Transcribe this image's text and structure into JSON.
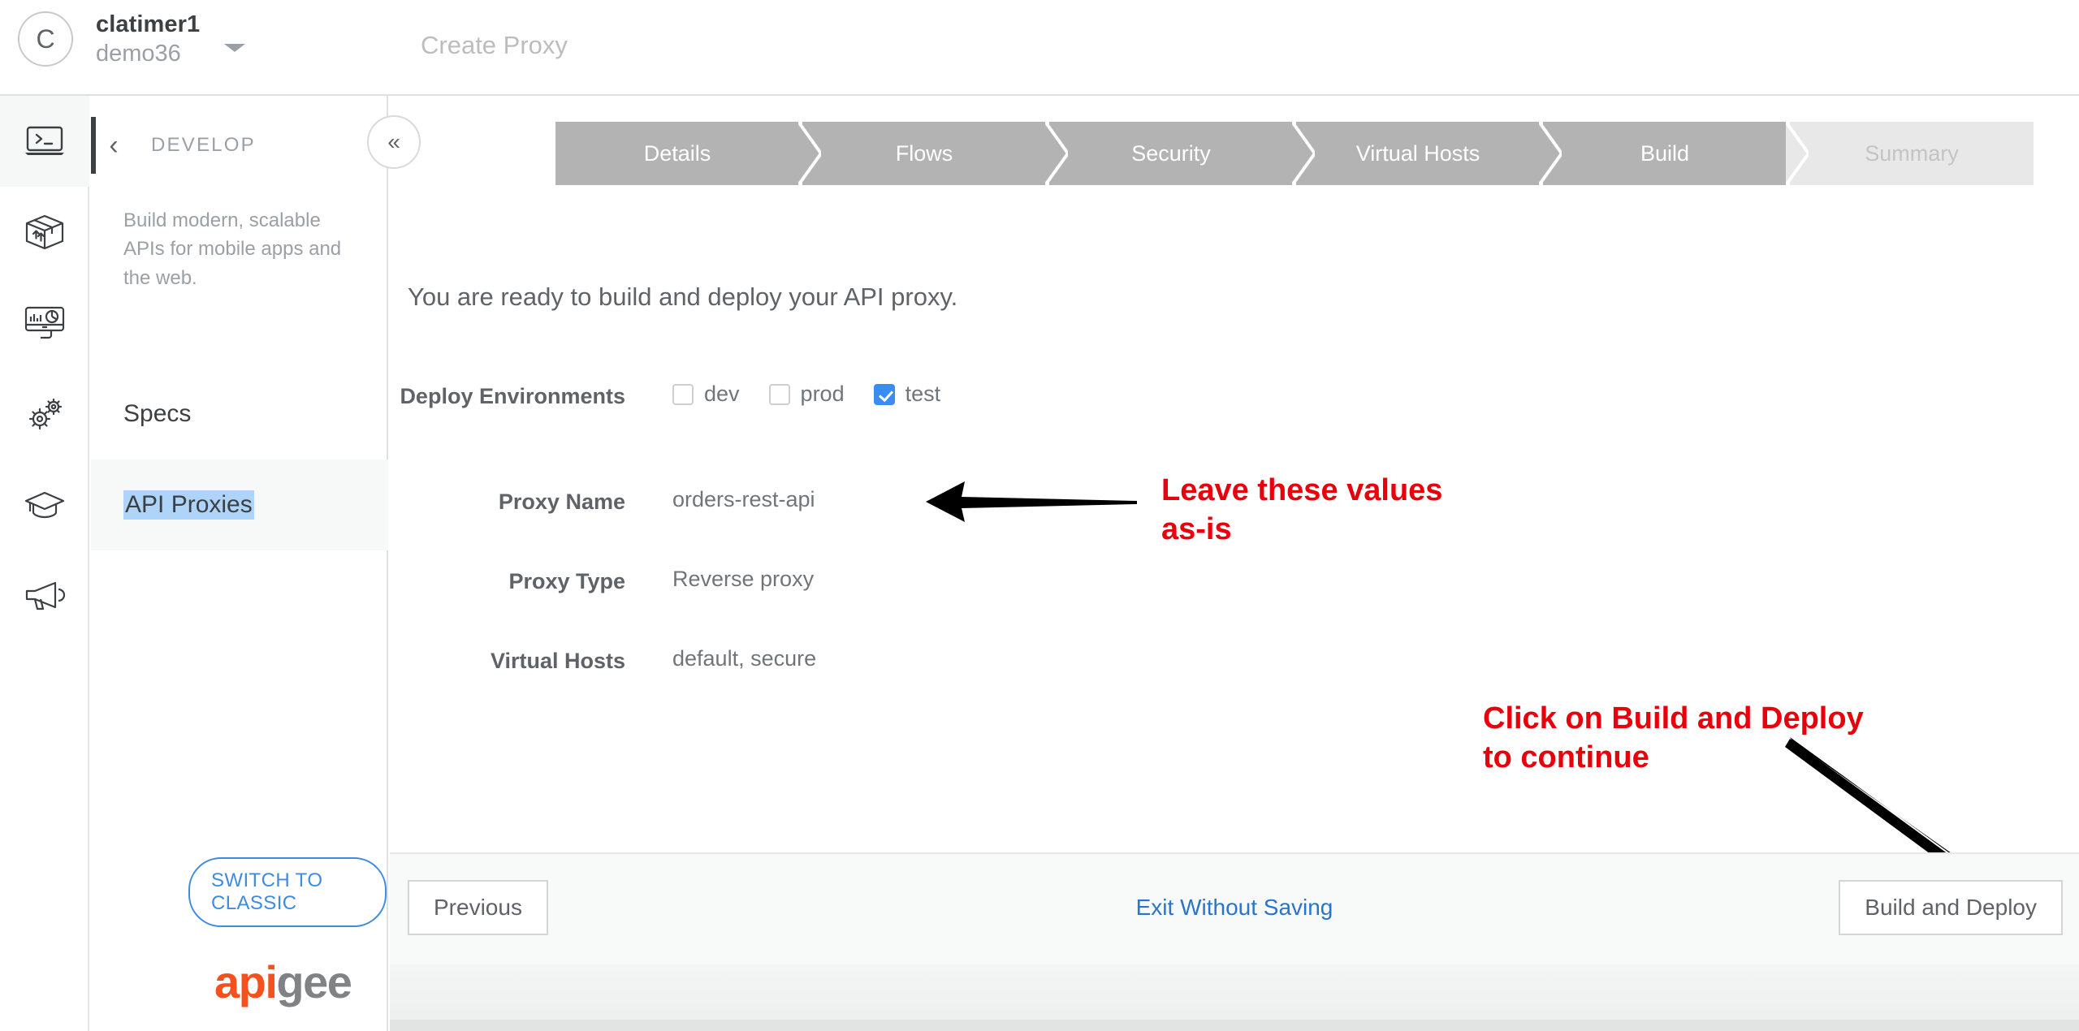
{
  "topbar": {
    "avatar_initial": "C",
    "username": "clatimer1",
    "org": "demo36",
    "page_title": "Create Proxy"
  },
  "rail": {
    "items": [
      {
        "icon": "console-icon",
        "name": "console",
        "active": true
      },
      {
        "icon": "package-icon",
        "name": "publish",
        "active": false
      },
      {
        "icon": "analytics-monitor-icon",
        "name": "analyze",
        "active": false
      },
      {
        "icon": "gears-icon",
        "name": "admin",
        "active": false
      },
      {
        "icon": "graduation-cap-icon",
        "name": "learn",
        "active": false
      },
      {
        "icon": "megaphone-icon",
        "name": "announcements",
        "active": false
      }
    ]
  },
  "develop_panel": {
    "back_icon": "chevron-left-icon",
    "title": "DEVELOP",
    "description": "Build modern, scalable APIs for mobile apps and the web.",
    "links": [
      {
        "label": "Specs",
        "selected": false,
        "highlighted": false
      },
      {
        "label": "API Proxies",
        "selected": true,
        "highlighted": true
      }
    ],
    "switch_classic": "SWITCH TO CLASSIC",
    "logo": {
      "part1": "api",
      "part2": "gee",
      "color1": "#f4511e",
      "color2": "#808285"
    }
  },
  "collapse_button": {
    "icon": "double-chevron-left-icon",
    "label": "«"
  },
  "wizard": {
    "steps": [
      {
        "label": "Details",
        "state": "done"
      },
      {
        "label": "Flows",
        "state": "done"
      },
      {
        "label": "Security",
        "state": "done"
      },
      {
        "label": "Virtual Hosts",
        "state": "done"
      },
      {
        "label": "Build",
        "state": "current"
      },
      {
        "label": "Summary",
        "state": "inactive"
      }
    ],
    "intro": "You are ready to build and deploy your API proxy.",
    "fields": [
      {
        "label": "Deploy Environments",
        "type": "checkboxes",
        "options": [
          {
            "label": "dev",
            "checked": false
          },
          {
            "label": "prod",
            "checked": false
          },
          {
            "label": "test",
            "checked": true
          }
        ]
      },
      {
        "label": "Proxy Name",
        "type": "text",
        "value": "orders-rest-api"
      },
      {
        "label": "Proxy Type",
        "type": "text",
        "value": "Reverse proxy"
      },
      {
        "label": "Virtual Hosts",
        "type": "text",
        "value": "default, secure"
      }
    ],
    "footer": {
      "previous": "Previous",
      "exit": "Exit Without Saving",
      "build_deploy": "Build and Deploy"
    }
  },
  "annotations": {
    "color": "#e8000b",
    "note1_line1": "Leave these values",
    "note1_line2": "as-is",
    "note2_line1": "Click on Build and Deploy",
    "note2_line2": "to continue"
  }
}
